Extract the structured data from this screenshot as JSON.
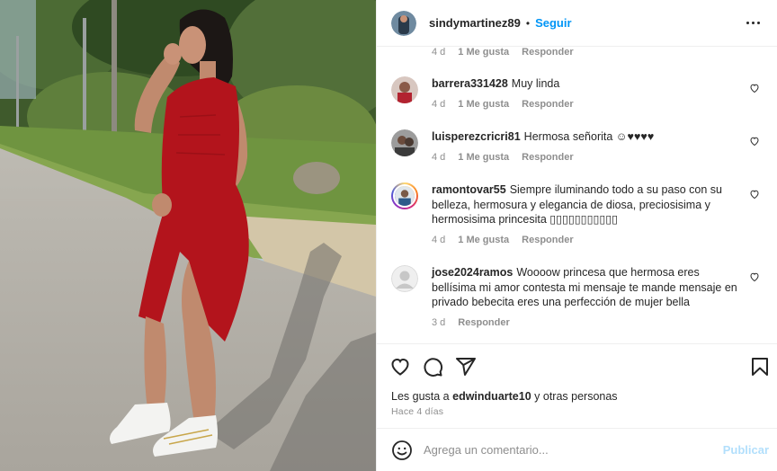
{
  "post": {
    "username": "sindymartinez89",
    "separator": "•",
    "follow_label": "Seguir",
    "more_icon": "more-horizontal-icon"
  },
  "comments": [
    {
      "username": "",
      "text": "",
      "time": "4 d",
      "likes": "1 Me gusta",
      "reply": "Responder"
    },
    {
      "username": "barrera331428",
      "text": "Muy linda",
      "time": "4 d",
      "likes": "1 Me gusta",
      "reply": "Responder"
    },
    {
      "username": "luisperezcricri81",
      "text": "Hermosa señorita ☺♥♥♥♥",
      "time": "4 d",
      "likes": "1 Me gusta",
      "reply": "Responder"
    },
    {
      "username": "ramontovar55",
      "text": "Siempre iluminando todo a su paso con su belleza, hermosura y elegancia de diosa, preciosisima y hermosisima princesita ▯▯▯▯▯▯▯▯▯▯▯",
      "time": "4 d",
      "likes": "1 Me gusta",
      "reply": "Responder"
    },
    {
      "username": "jose2024ramos",
      "text": "Woooow princesa que hermosa eres bellísima mi amor contesta mi mensaje te mande mensaje en privado bebecita eres una perfección de mujer bella",
      "time": "3 d",
      "reply": "Responder"
    }
  ],
  "actions": {
    "like_icon": "heart-icon",
    "comment_icon": "comment-icon",
    "share_icon": "share-icon",
    "save_icon": "bookmark-icon",
    "likes_prefix": "Les gusta a",
    "likes_user": "edwinduarte10",
    "likes_suffix": "y otras personas",
    "posted_ago": "Hace 4 días"
  },
  "composer": {
    "emoji_icon": "emoji-icon",
    "placeholder": "Agrega un comentario...",
    "post_label": "Publicar"
  },
  "colors": {
    "accent": "#0095f6",
    "accent_disabled": "#b2dffc",
    "secondary_text": "#8e8e8e",
    "dress": "#b3141c"
  }
}
